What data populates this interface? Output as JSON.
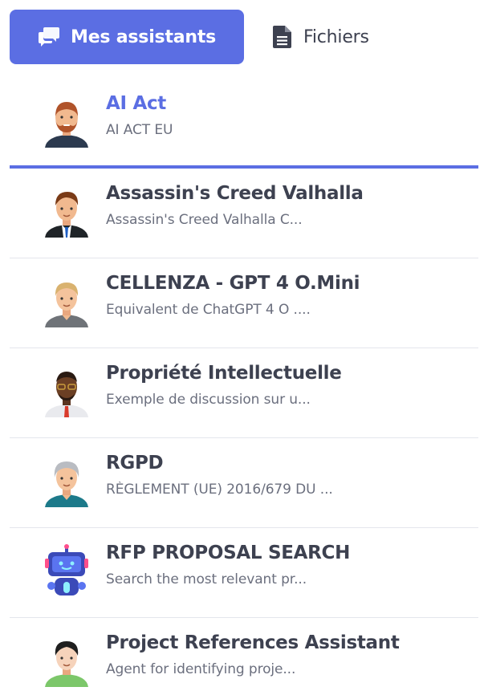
{
  "tabs": {
    "assistants": {
      "label": "Mes assistants",
      "icon": "chat-bubbles-icon"
    },
    "files": {
      "label": "Fichiers",
      "icon": "document-icon"
    }
  },
  "accent_color": "#5b6ee3",
  "assistants": [
    {
      "title": "AI Act",
      "subtitle": "AI ACT EU",
      "avatar": "avatar-bearded-man-icon",
      "selected": true
    },
    {
      "title": "Assassin's Creed Valhalla",
      "subtitle": "Assassin's Creed Valhalla C...",
      "avatar": "avatar-businessman-icon"
    },
    {
      "title": "CELLENZA - GPT 4 O.Mini",
      "subtitle": "Equivalent de ChatGPT 4 O ....",
      "avatar": "avatar-blond-man-icon"
    },
    {
      "title": "Propriété Intellectuelle",
      "subtitle": "Exemple de discussion sur u...",
      "avatar": "avatar-man-glasses-icon"
    },
    {
      "title": "RGPD",
      "subtitle": "RÈGLEMENT (UE) 2016/679 DU ...",
      "avatar": "avatar-grey-haired-man-icon"
    },
    {
      "title": "RFP PROPOSAL SEARCH",
      "subtitle": "Search the most relevant pr...",
      "avatar": "robot-icon"
    },
    {
      "title": "Project References Assistant",
      "subtitle": "Agent for identifying proje...",
      "avatar": "avatar-young-man-icon"
    }
  ]
}
